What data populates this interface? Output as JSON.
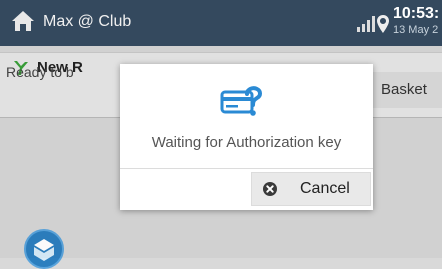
{
  "header": {
    "title": "Max @ Club",
    "time": "10:53:",
    "date": "13 May 2"
  },
  "panel": {
    "title": "New R",
    "status": "Ready to b",
    "basket_label": "Basket"
  },
  "dialog": {
    "message": "Waiting for Authorization key",
    "cancel_label": "Cancel"
  },
  "colors": {
    "appbar": "#34495e",
    "accent_icon": "#2a8ad4",
    "panel_icon": "#3aa03a"
  }
}
